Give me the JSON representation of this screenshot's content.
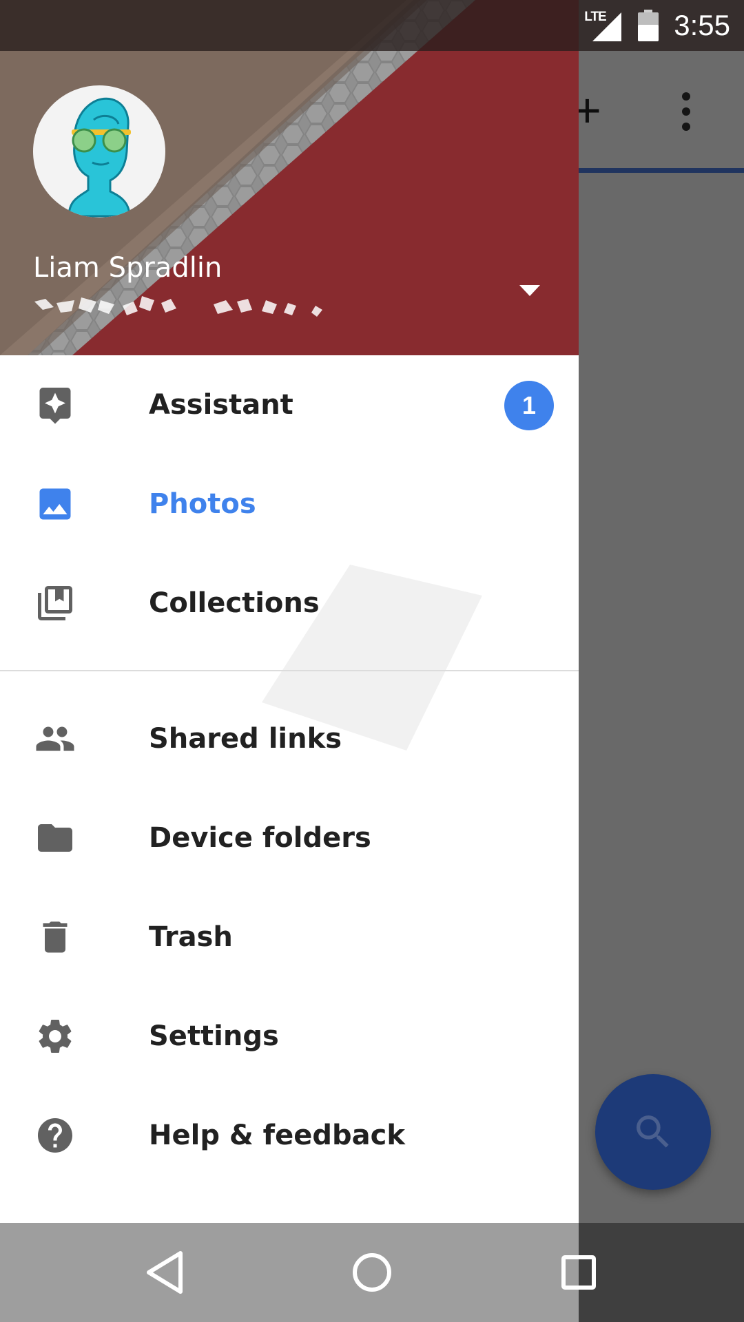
{
  "status_bar": {
    "network": "LTE",
    "time": "3:55"
  },
  "background_app": {
    "add_icon": "plus-icon",
    "more_icon": "more-vert-icon",
    "fab_icon": "search-icon"
  },
  "drawer": {
    "account": {
      "name": "Liam Spradlin",
      "toggle_icon": "arrow-drop-down-icon"
    },
    "items": [
      {
        "label": "Assistant",
        "icon": "assistant-icon",
        "badge": "1",
        "active": false
      },
      {
        "label": "Photos",
        "icon": "photo-icon",
        "active": true
      },
      {
        "label": "Collections",
        "icon": "collections-icon",
        "active": false
      }
    ],
    "secondary_items": [
      {
        "label": "Shared links",
        "icon": "people-icon"
      },
      {
        "label": "Device folders",
        "icon": "folder-icon"
      },
      {
        "label": "Trash",
        "icon": "trash-icon"
      },
      {
        "label": "Settings",
        "icon": "gear-icon"
      },
      {
        "label": "Help & feedback",
        "icon": "help-icon"
      }
    ]
  },
  "nav_bar": {
    "back_icon": "back-icon",
    "home_icon": "home-icon",
    "recents_icon": "recents-icon"
  },
  "colors": {
    "accent": "#3f82ec",
    "header_red": "#8a2a2e",
    "fab": "#1d3a78"
  }
}
